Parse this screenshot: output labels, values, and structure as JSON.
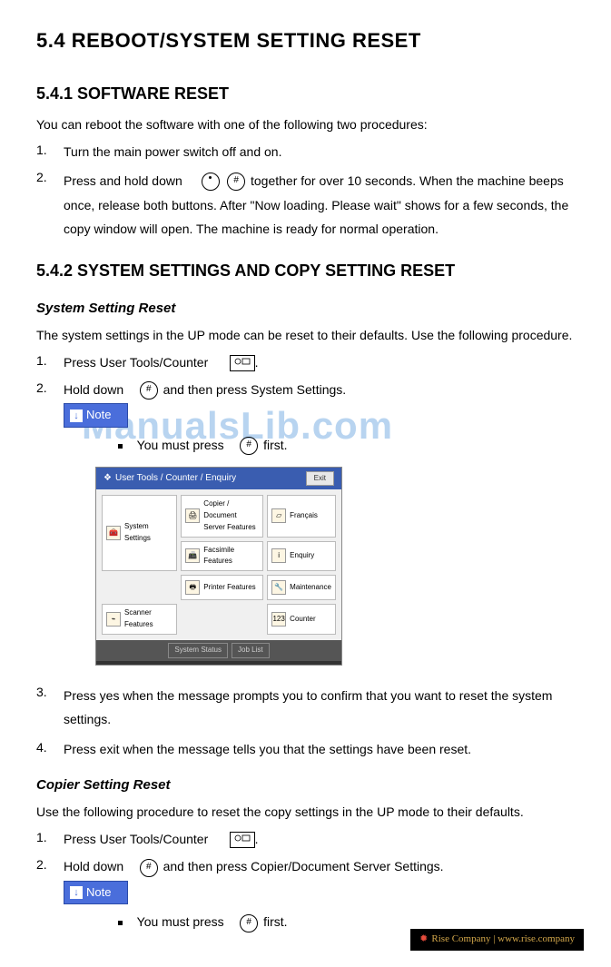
{
  "h1": "5.4 REBOOT/SYSTEM SETTING RESET",
  "h2_1": "5.4.1 SOFTWARE RESET",
  "intro": "You can reboot the software with one of the following two procedures:",
  "steps1": [
    {
      "n": "1.",
      "t": "Turn the main power switch off and on."
    },
    {
      "n": "2.",
      "pre": "Press and hold down ",
      "post": " together for over 10 seconds. When the machine beeps once, release both buttons. After \"Now loading. Please wait\" shows for a few seconds, the copy window will open. The machine is ready for normal operation."
    }
  ],
  "h2_2": "5.4.2 SYSTEM SETTINGS AND COPY SETTING RESET",
  "h3_1": "System Setting Reset",
  "p2": "The system settings in the UP mode can be reset to their defaults. Use the following procedure.",
  "s2_1": {
    "n": "1.",
    "pre": "Press User Tools/Counter ",
    "post": "."
  },
  "s2_2": {
    "n": "2.",
    "pre": "Hold down ",
    "post": " and then press System Settings."
  },
  "note": "Note",
  "note_sub_pre": "You must press ",
  "note_sub_post": " first.",
  "device": {
    "title": "User Tools / Counter / Enquiry",
    "exit": "Exit",
    "cells": {
      "system": "System Settings",
      "copier": "Copier / Document Server Features",
      "french": "Français",
      "fax": "Facsimile Features",
      "enquiry": "Enquiry",
      "printer": "Printer Features",
      "maint": "Maintenance",
      "scanner": "Scanner Features",
      "counter": "Counter"
    },
    "footer1": "System Status",
    "footer2": "Job List"
  },
  "s2_3": {
    "n": "3.",
    "t": "Press yes when the message prompts you to confirm that you want to reset the system settings."
  },
  "s2_4": {
    "n": "4.",
    "t": "Press exit when the message tells you that the settings have been reset."
  },
  "h3_2": "Copier Setting Reset",
  "p3": "Use the following procedure to reset the copy settings in the UP mode to their defaults.",
  "s3_1": {
    "n": "1.",
    "pre": "Press User Tools/Counter ",
    "post": "."
  },
  "s3_2": {
    "n": "2.",
    "pre": "Hold down ",
    "post": " and then press Copier/Document Server Settings."
  },
  "watermark": "ManualsLib.com",
  "rise": "Rise Company | www.rise.company"
}
